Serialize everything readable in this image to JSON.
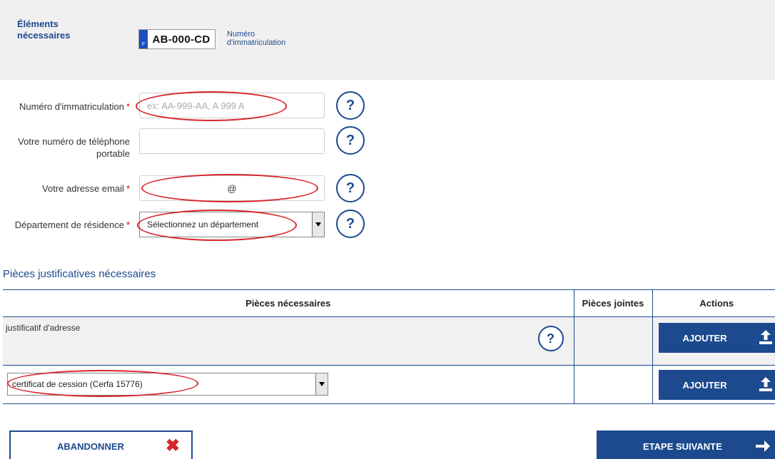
{
  "header": {
    "title_line1": "Éléments",
    "title_line2": "nécessaires",
    "plate_text": "AB-000-CD",
    "plate_country": "F",
    "plate_caption_line1": "Numéro",
    "plate_caption_line2": "d'immatriculation"
  },
  "form": {
    "immatriculation": {
      "label": "Numéro d'immatriculation",
      "required_mark": "*",
      "placeholder": "ex: AA-999-AA, A 999 A",
      "value": ""
    },
    "phone": {
      "label_line1": "Votre numéro de téléphone",
      "label_line2": "portable",
      "value": ""
    },
    "email": {
      "label": "Votre adresse email",
      "required_mark": "*",
      "value": "@"
    },
    "departement": {
      "label": "Département de résidence",
      "required_mark": "*",
      "selected": "Sélectionnez un département"
    },
    "help_glyph": "?"
  },
  "pieces": {
    "section_title": "Pièces justificatives nécessaires",
    "columns": [
      "Pièces nécessaires",
      "Pièces jointes",
      "Actions"
    ],
    "rows": [
      {
        "piece": "justificatif d'adresse",
        "jointes": "",
        "action": "AJOUTER"
      },
      {
        "piece_select": "certificat de cession (Cerfa 15776)",
        "jointes": "",
        "action": "AJOUTER"
      }
    ]
  },
  "buttons": {
    "abandon": "ABANDONNER",
    "next": "ETAPE SUIVANTE"
  },
  "colors": {
    "primary": "#1d4a8e",
    "highlight": "#d8232a",
    "panel": "#f0f0f0"
  }
}
